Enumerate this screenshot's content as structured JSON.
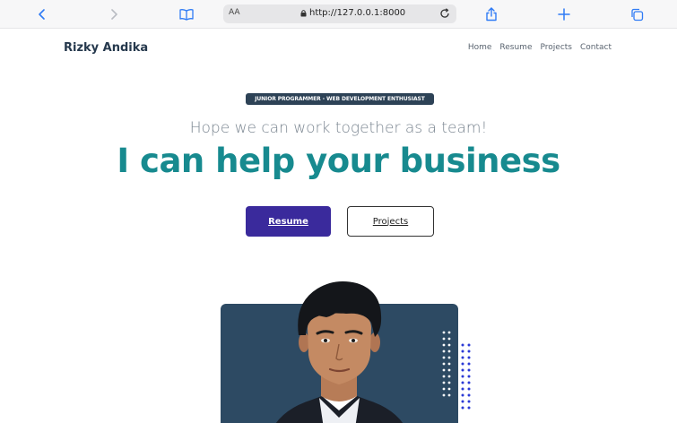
{
  "browser": {
    "url_aa": "AA",
    "url": "http://127.0.0.1:8000",
    "icons": [
      "back-icon",
      "forward-icon",
      "bookmarks-icon",
      "lock-icon",
      "reload-icon",
      "share-icon",
      "new-tab-icon",
      "tabs-icon"
    ]
  },
  "site": {
    "brand": "Rizky Andika",
    "nav": [
      "Home",
      "Resume",
      "Projects",
      "Contact"
    ]
  },
  "hero": {
    "badge": "JUNIOR PROGRAMMER - WEB DEVELOPMENT ENTHUSIAST",
    "subline": "Hope we can work together as a team!",
    "headline": "I can help your business",
    "primary_button": "Resume",
    "secondary_button": "Projects"
  },
  "colors": {
    "accent": "#178a8f",
    "primary_button": "#3a2a9c",
    "card": "#2d4a63",
    "badge": "#2d4256"
  }
}
